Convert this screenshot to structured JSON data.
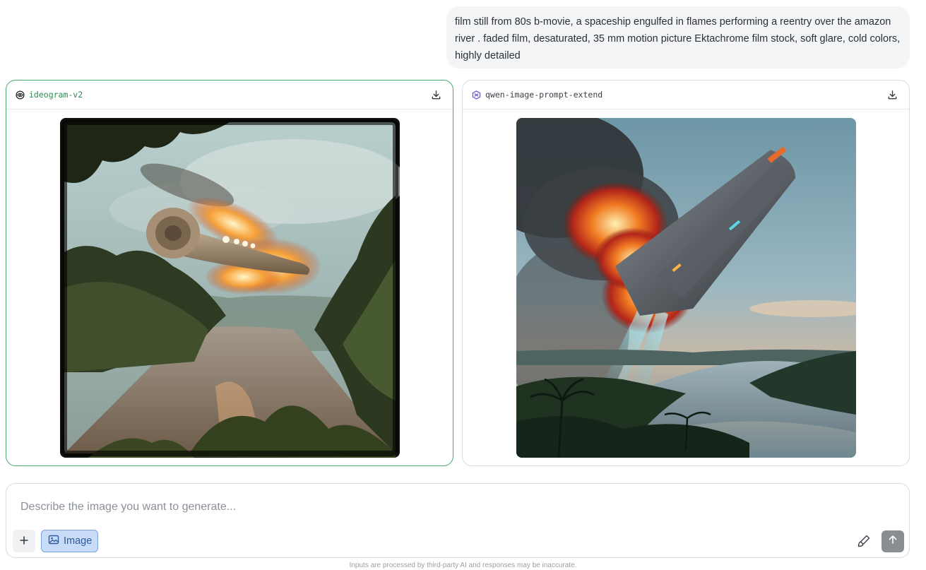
{
  "prompt": {
    "text": "film still from 80s b-movie, a spaceship engulfed in flames performing a reentry over the amazon river . faded film, desaturated, 35 mm motion picture Ektachrome film stock, soft glare, cold colors, highly detailed"
  },
  "results": [
    {
      "model": "ideogram-v2",
      "icon": "ideogram-logo-icon",
      "selected": true,
      "action_icon": "download-icon"
    },
    {
      "model": "qwen-image-prompt-extend",
      "icon": "qwen-logo-icon",
      "selected": false,
      "action_icon": "download-icon"
    }
  ],
  "composer": {
    "placeholder": "Describe the image you want to generate...",
    "add_icon": "plus-icon",
    "mode_label": "Image",
    "mode_icon": "image-icon",
    "enhance_icon": "paintbrush-icon",
    "send_icon": "arrow-up-icon"
  },
  "disclaimer": "Inputs are processed by third-party AI and responses may be inaccurate.",
  "colors": {
    "selected_border": "#46a86a",
    "mode_button_bg": "#c9dcf7",
    "send_button_bg": "#8a8d92"
  }
}
